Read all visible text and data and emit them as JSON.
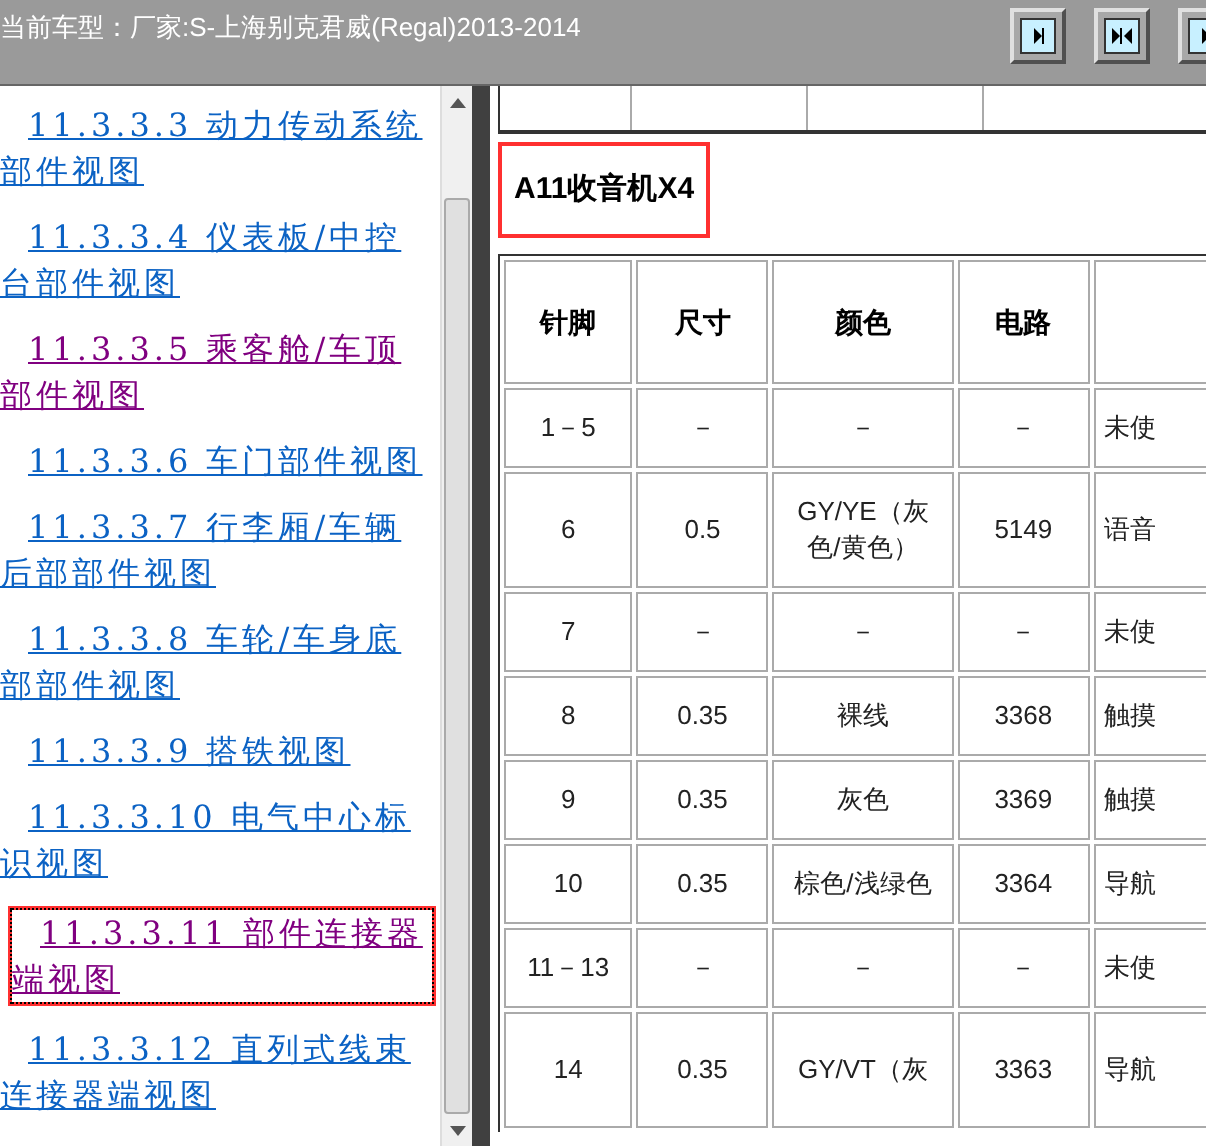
{
  "header": {
    "title": "当前车型：厂家:S-上海别克君威(Regal)2013-2014"
  },
  "nav_links": [
    {
      "text": "11.3.3.3 动力传动系统部件视图",
      "visited": false,
      "focused": false,
      "highlighted": false
    },
    {
      "text": "11.3.3.4 仪表板/中控台部件视图",
      "visited": false,
      "focused": false,
      "highlighted": false
    },
    {
      "text": "11.3.3.5 乘客舱/车顶部件视图",
      "visited": true,
      "focused": false,
      "highlighted": false
    },
    {
      "text": "11.3.3.6 车门部件视图",
      "visited": false,
      "focused": false,
      "highlighted": false
    },
    {
      "text": "11.3.3.7 行李厢/车辆后部部件视图",
      "visited": false,
      "focused": false,
      "highlighted": false
    },
    {
      "text": "11.3.3.8 车轮/车身底部部件视图",
      "visited": false,
      "focused": false,
      "highlighted": false
    },
    {
      "text": "11.3.3.9 搭铁视图",
      "visited": false,
      "focused": false,
      "highlighted": false
    },
    {
      "text": "11.3.3.10 电气中心标识视图",
      "visited": false,
      "focused": false,
      "highlighted": false
    },
    {
      "text": "11.3.3.11 部件连接器端视图",
      "visited": true,
      "focused": true,
      "highlighted": true
    },
    {
      "text": "11.3.3.12 直列式线束连接器端视图",
      "visited": false,
      "focused": false,
      "highlighted": false
    }
  ],
  "content": {
    "heading": {
      "text": "A11收音机X4",
      "highlighted": true
    },
    "table": {
      "columns": [
        "针脚",
        "尺寸",
        "颜色",
        "电路",
        ""
      ],
      "rows": [
        [
          "1－5",
          "－",
          "－",
          "－",
          "未使"
        ],
        [
          "6",
          "0.5",
          "GY/YE（灰色/黄色）",
          "5149",
          "语音"
        ],
        [
          "7",
          "－",
          "－",
          "－",
          "未使"
        ],
        [
          "8",
          "0.35",
          "裸线",
          "3368",
          "触摸"
        ],
        [
          "9",
          "0.35",
          "灰色",
          "3369",
          "触摸"
        ],
        [
          "10",
          "0.35",
          "棕色/浅绿色",
          "3364",
          "导航"
        ],
        [
          "11－13",
          "－",
          "－",
          "－",
          "未使"
        ],
        [
          "14",
          "0.35",
          "GY/VT（灰",
          "3363",
          "导航"
        ]
      ]
    }
  }
}
